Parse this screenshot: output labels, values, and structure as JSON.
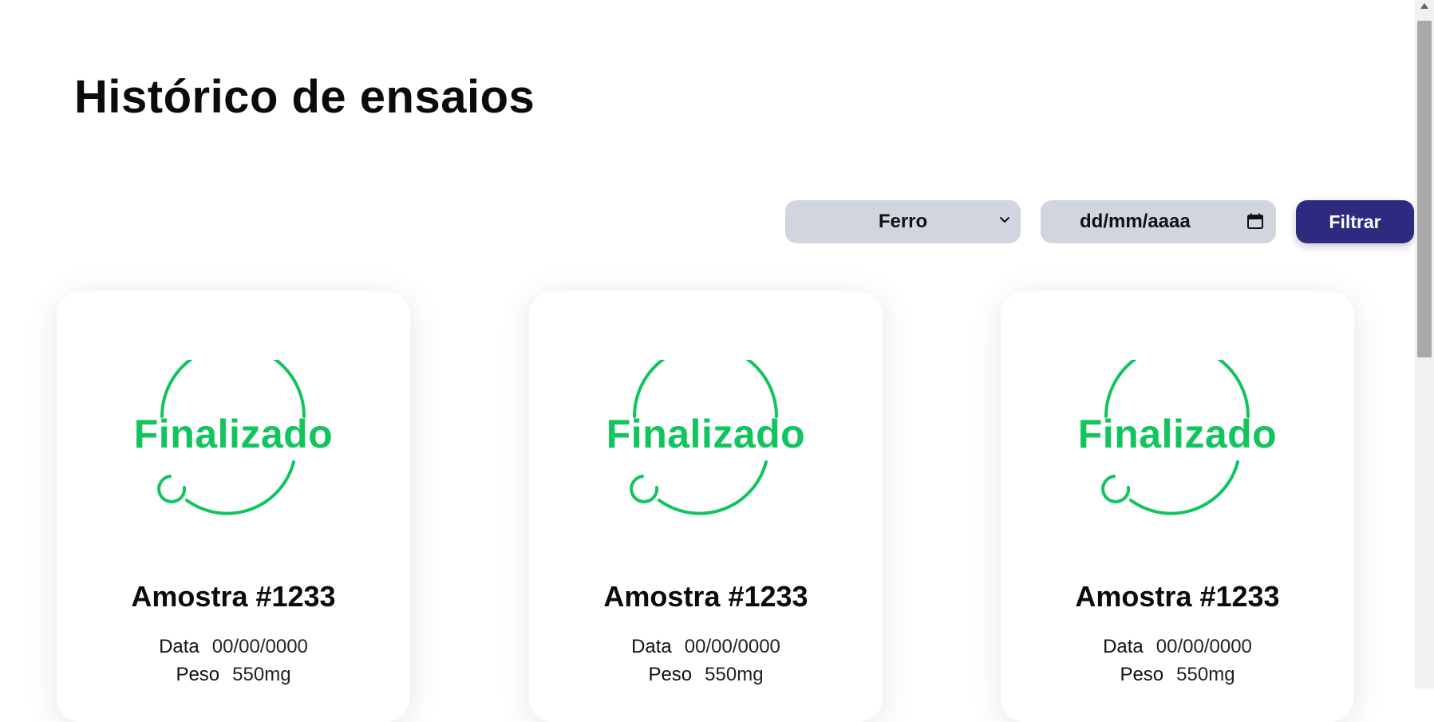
{
  "page": {
    "title": "Histórico de ensaios"
  },
  "filters": {
    "material_select": {
      "selected": "Ferro"
    },
    "date_input": {
      "placeholder": "dd/mm/aaaa"
    },
    "filter_button": {
      "label": "Filtrar"
    }
  },
  "cards": [
    {
      "status": "Finalizado",
      "title": "Amostra #1233",
      "data_label": "Data",
      "data_value": "00/00/0000",
      "peso_label": "Peso",
      "peso_value": "550mg"
    },
    {
      "status": "Finalizado",
      "title": "Amostra #1233",
      "data_label": "Data",
      "data_value": "00/00/0000",
      "peso_label": "Peso",
      "peso_value": "550mg"
    },
    {
      "status": "Finalizado",
      "title": "Amostra #1233",
      "data_label": "Data",
      "data_value": "00/00/0000",
      "peso_label": "Peso",
      "peso_value": "550mg"
    }
  ],
  "colors": {
    "status_green": "#12c45e",
    "primary_button": "#2e2a7f",
    "input_bg": "#d1d5dd"
  },
  "icons": {
    "select_chevron": "chevron-down-icon",
    "date_picker": "calendar-icon",
    "status": "spinner-ring-icon"
  }
}
